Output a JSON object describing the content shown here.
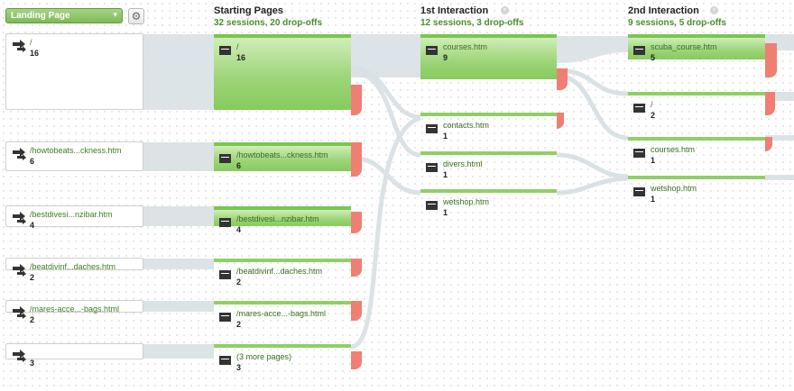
{
  "toolbar": {
    "dimension_label": "Landing Page",
    "caret": "▾",
    "gear_icon": "gear-icon",
    "gear_glyph": "⚙"
  },
  "columns": [
    {
      "title": "Starting Pages",
      "summary": "32 sessions, 20 drop-offs",
      "closeable": false
    },
    {
      "title": "1st Interaction",
      "summary": "12 sessions, 3 drop-offs",
      "closeable": true
    },
    {
      "title": "2nd Interaction",
      "summary": "9 sessions, 5 drop-offs",
      "closeable": true
    }
  ],
  "close_glyph": "×",
  "sources": [
    {
      "label": "/",
      "count": "16"
    },
    {
      "label": "/howtobeats...ckness.htm",
      "count": "6"
    },
    {
      "label": "/bestdivesi...nzibar.htm",
      "count": "4"
    },
    {
      "label": "/beatdivinf...daches.htm",
      "count": "2"
    },
    {
      "label": "/mares-acce...-bags.html",
      "count": "2"
    },
    {
      "label": "",
      "count": "3"
    }
  ],
  "starting_pages": [
    {
      "label": "/",
      "count": "16"
    },
    {
      "label": "/howtobeats...ckness.htm",
      "count": "6"
    },
    {
      "label": "/bestdivesi...nzibar.htm",
      "count": "4"
    },
    {
      "label": "/beatdivinf...daches.htm",
      "count": "2"
    },
    {
      "label": "/mares-acce...-bags.html",
      "count": "2"
    },
    {
      "label": "(3 more pages)",
      "count": "3"
    }
  ],
  "interaction1": [
    {
      "label": "courses.htm",
      "count": "9"
    },
    {
      "label": "contacts.htm",
      "count": "1"
    },
    {
      "label": "divers.html",
      "count": "1"
    },
    {
      "label": "wetshop.htm",
      "count": "1"
    }
  ],
  "interaction2": [
    {
      "label": "scuba_course.htm",
      "count": "5"
    },
    {
      "label": "/",
      "count": "2"
    },
    {
      "label": "courses.htm",
      "count": "1"
    },
    {
      "label": "wetshop.htm",
      "count": "1"
    }
  ],
  "colors": {
    "accent_green": "#86cb5c",
    "drop_off_red": "#ef7f72",
    "flow_gray": "#d9e1e4",
    "label_green": "#3f7c1f"
  }
}
